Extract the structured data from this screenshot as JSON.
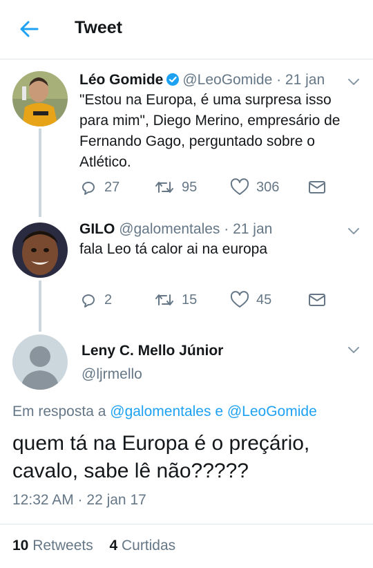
{
  "header": {
    "title": "Tweet"
  },
  "thread": [
    {
      "name": "Léo Gomide",
      "verified": true,
      "handle": "@LeoGomide",
      "date": "21 jan",
      "text": "\"Estou na Europa, é uma surpresa isso para mim\", Diego Merino, empresário de Fernando Gago, perguntado sobre o Atlético.",
      "replies": "27",
      "retweets": "95",
      "likes": "306"
    },
    {
      "name": "GILO",
      "verified": false,
      "handle": "@galomentales",
      "date": "21 jan",
      "text": "fala Leo tá calor ai na europa",
      "replies": "2",
      "retweets": "15",
      "likes": "45"
    }
  ],
  "main_tweet": {
    "name": "Leny C. Mello Júnior",
    "handle": "@ljrmello",
    "reply_prefix": "Em resposta a",
    "reply_to_1": "@galomentales",
    "reply_and": "e",
    "reply_to_2": "@LeoGomide",
    "text": "quem tá na Europa é o preçário, cavalo, sabe lê não?????",
    "timestamp": "12:32 AM · 22 jan 17",
    "retweets_count": "10",
    "retweets_label": "Retweets",
    "likes_count": "4",
    "likes_label": "Curtidas"
  },
  "colors": {
    "accent": "#1da1f2",
    "text": "#14171a",
    "muted": "#657786",
    "divider": "#e1e8ed"
  }
}
